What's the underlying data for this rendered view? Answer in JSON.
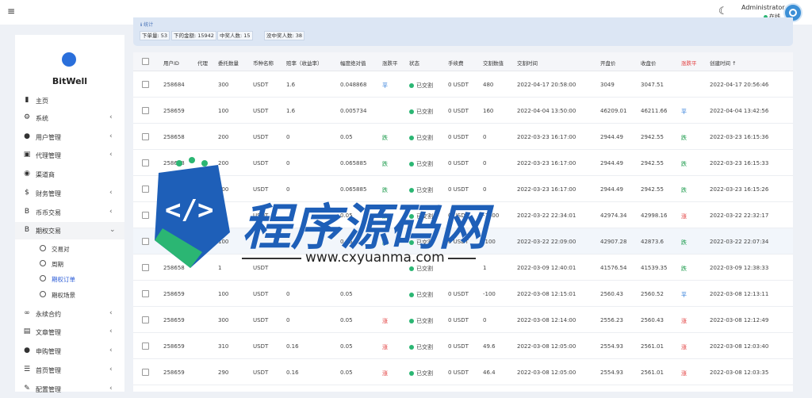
{
  "header": {
    "menu_icon": "hamburger-icon",
    "theme_icon": "moon-icon",
    "user_name": "Administrator",
    "user_status": "在线"
  },
  "sidebar": {
    "brand": "BitWell",
    "items": [
      {
        "label": "主页",
        "icon": "chart-icon",
        "arrow": false
      },
      {
        "label": "系统",
        "icon": "gear-icon",
        "arrow": true
      },
      {
        "label": "用户管理",
        "icon": "user-icon",
        "arrow": true
      },
      {
        "label": "代理管理",
        "icon": "id-card-icon",
        "arrow": true
      },
      {
        "label": "渠道商",
        "icon": "user-circle-icon",
        "arrow": false
      },
      {
        "label": "财务管理",
        "icon": "dollar-icon",
        "arrow": true
      },
      {
        "label": "币币交易",
        "icon": "bitcoin-icon",
        "arrow": true
      },
      {
        "label": "期权交易",
        "icon": "bitcoin-icon",
        "arrow": true,
        "expanded": true
      },
      {
        "label": "永续合约",
        "icon": "link-icon",
        "arrow": true
      },
      {
        "label": "文章管理",
        "icon": "newspaper-icon",
        "arrow": true
      },
      {
        "label": "申购管理",
        "icon": "circle-icon",
        "arrow": true
      },
      {
        "label": "首页管理",
        "icon": "list-icon",
        "arrow": true
      },
      {
        "label": "配置管理",
        "icon": "wrench-icon",
        "arrow": true
      }
    ],
    "sub_items": [
      {
        "label": "交易对",
        "active": false
      },
      {
        "label": "周期",
        "active": false
      },
      {
        "label": "期权订单",
        "active": true
      },
      {
        "label": "期权场景",
        "active": false
      }
    ]
  },
  "stats": {
    "tip": "ℹ 统计",
    "chips": [
      "下单量: 53",
      "下的金额: 15942",
      "中奖人数: 15",
      "没中奖人数: 38"
    ]
  },
  "table": {
    "headers": [
      "用户ID",
      "代理",
      "委托数量",
      "币种名称",
      "赔率（收益率）",
      "幅度绝对值",
      "涨跌平",
      "状态",
      "手续费",
      "交割数值",
      "交割时间",
      "开盘价",
      "收盘价",
      "涨跌平",
      "创建时间 ↑"
    ],
    "rows": [
      {
        "uid": "258684",
        "agent": "",
        "qty": "300",
        "coin": "USDT",
        "odds": "1.6",
        "amp": "0.048868",
        "dir": "平",
        "dir_t": "flat",
        "status": "已交割",
        "fee": "0 USDT",
        "val": "480",
        "time": "2022-04-17 20:58:00",
        "open": "3049",
        "close": "3047.51",
        "res": "",
        "res_t": "",
        "created": "2022-04-17 20:56:46"
      },
      {
        "uid": "258659",
        "agent": "",
        "qty": "100",
        "coin": "USDT",
        "odds": "1.6",
        "amp": "0.005734",
        "dir": "",
        "dir_t": "",
        "status": "已交割",
        "fee": "0 USDT",
        "val": "160",
        "time": "2022-04-04 13:50:00",
        "open": "46209.01",
        "close": "46211.66",
        "res": "平",
        "res_t": "flat",
        "created": "2022-04-04 13:42:56"
      },
      {
        "uid": "258658",
        "agent": "",
        "qty": "200",
        "coin": "USDT",
        "odds": "0",
        "amp": "0.05",
        "dir": "跌",
        "dir_t": "down",
        "status": "已交割",
        "fee": "0 USDT",
        "val": "0",
        "time": "2022-03-23 16:17:00",
        "open": "2944.49",
        "close": "2942.55",
        "res": "跌",
        "res_t": "down",
        "created": "2022-03-23 16:15:36"
      },
      {
        "uid": "258658",
        "agent": "",
        "qty": "200",
        "coin": "USDT",
        "odds": "0",
        "amp": "0.065885",
        "dir": "跌",
        "dir_t": "down",
        "status": "已交割",
        "fee": "0 USDT",
        "val": "0",
        "time": "2022-03-23 16:17:00",
        "open": "2944.49",
        "close": "2942.55",
        "res": "跌",
        "res_t": "down",
        "created": "2022-03-23 16:15:33"
      },
      {
        "uid": "",
        "agent": "",
        "qty": "200",
        "coin": "USDT",
        "odds": "0",
        "amp": "0.065885",
        "dir": "跌",
        "dir_t": "down",
        "status": "已交割",
        "fee": "0 USDT",
        "val": "0",
        "time": "2022-03-23 16:17:00",
        "open": "2944.49",
        "close": "2942.55",
        "res": "跌",
        "res_t": "down",
        "created": "2022-03-23 16:15:26"
      },
      {
        "uid": "",
        "agent": "",
        "qty": "00",
        "coin": "USDT",
        "odds": "",
        "amp": "0.05",
        "dir": "跌",
        "dir_t": "down",
        "status": "已交割",
        "fee": "0 USDT",
        "val": "-1000",
        "time": "2022-03-22 22:34:01",
        "open": "42974.34",
        "close": "42998.16",
        "res": "涨",
        "res_t": "up",
        "created": "2022-03-22 22:32:17"
      },
      {
        "uid": "",
        "agent": "",
        "qty": "100",
        "coin": "",
        "odds": "",
        "amp": "0.05",
        "dir": "跌",
        "dir_t": "down",
        "status": "已交割",
        "fee": "0 USDT",
        "val": "-100",
        "time": "2022-03-22 22:09:00",
        "open": "42907.28",
        "close": "42873.6",
        "res": "跌",
        "res_t": "down",
        "created": "2022-03-22 22:07:34"
      },
      {
        "uid": "258658",
        "agent": "",
        "qty": "1",
        "coin": "USDT",
        "odds": "",
        "amp": "",
        "dir": "",
        "dir_t": "",
        "status": "已交割",
        "fee": "",
        "val": "1",
        "time": "2022-03-09 12:40:01",
        "open": "41576.54",
        "close": "41539.35",
        "res": "跌",
        "res_t": "down",
        "created": "2022-03-09 12:38:33"
      },
      {
        "uid": "258659",
        "agent": "",
        "qty": "100",
        "coin": "USDT",
        "odds": "0",
        "amp": "0.05",
        "dir": "",
        "dir_t": "",
        "status": "已交割",
        "fee": "0 USDT",
        "val": "-100",
        "time": "2022-03-08 12:15:01",
        "open": "2560.43",
        "close": "2560.52",
        "res": "平",
        "res_t": "flat",
        "created": "2022-03-08 12:13:11"
      },
      {
        "uid": "258659",
        "agent": "",
        "qty": "300",
        "coin": "USDT",
        "odds": "0",
        "amp": "0.05",
        "dir": "涨",
        "dir_t": "up",
        "status": "已交割",
        "fee": "0 USDT",
        "val": "0",
        "time": "2022-03-08 12:14:00",
        "open": "2556.23",
        "close": "2560.43",
        "res": "涨",
        "res_t": "up",
        "created": "2022-03-08 12:12:49"
      },
      {
        "uid": "258659",
        "agent": "",
        "qty": "310",
        "coin": "USDT",
        "odds": "0.16",
        "amp": "0.05",
        "dir": "涨",
        "dir_t": "up",
        "status": "已交割",
        "fee": "0 USDT",
        "val": "49.6",
        "time": "2022-03-08 12:05:00",
        "open": "2554.93",
        "close": "2561.01",
        "res": "涨",
        "res_t": "up",
        "created": "2022-03-08 12:03:40"
      },
      {
        "uid": "258659",
        "agent": "",
        "qty": "290",
        "coin": "USDT",
        "odds": "0.16",
        "amp": "0.05",
        "dir": "涨",
        "dir_t": "up",
        "status": "已交割",
        "fee": "0 USDT",
        "val": "46.4",
        "time": "2022-03-08 12:05:00",
        "open": "2554.93",
        "close": "2561.01",
        "res": "涨",
        "res_t": "up",
        "created": "2022-03-08 12:03:35"
      }
    ]
  },
  "watermark": {
    "title": "程序源码网",
    "url": "www.cxyuanma.com",
    "colors": {
      "blue": "#1e5fb8",
      "green": "#2bb673"
    }
  }
}
